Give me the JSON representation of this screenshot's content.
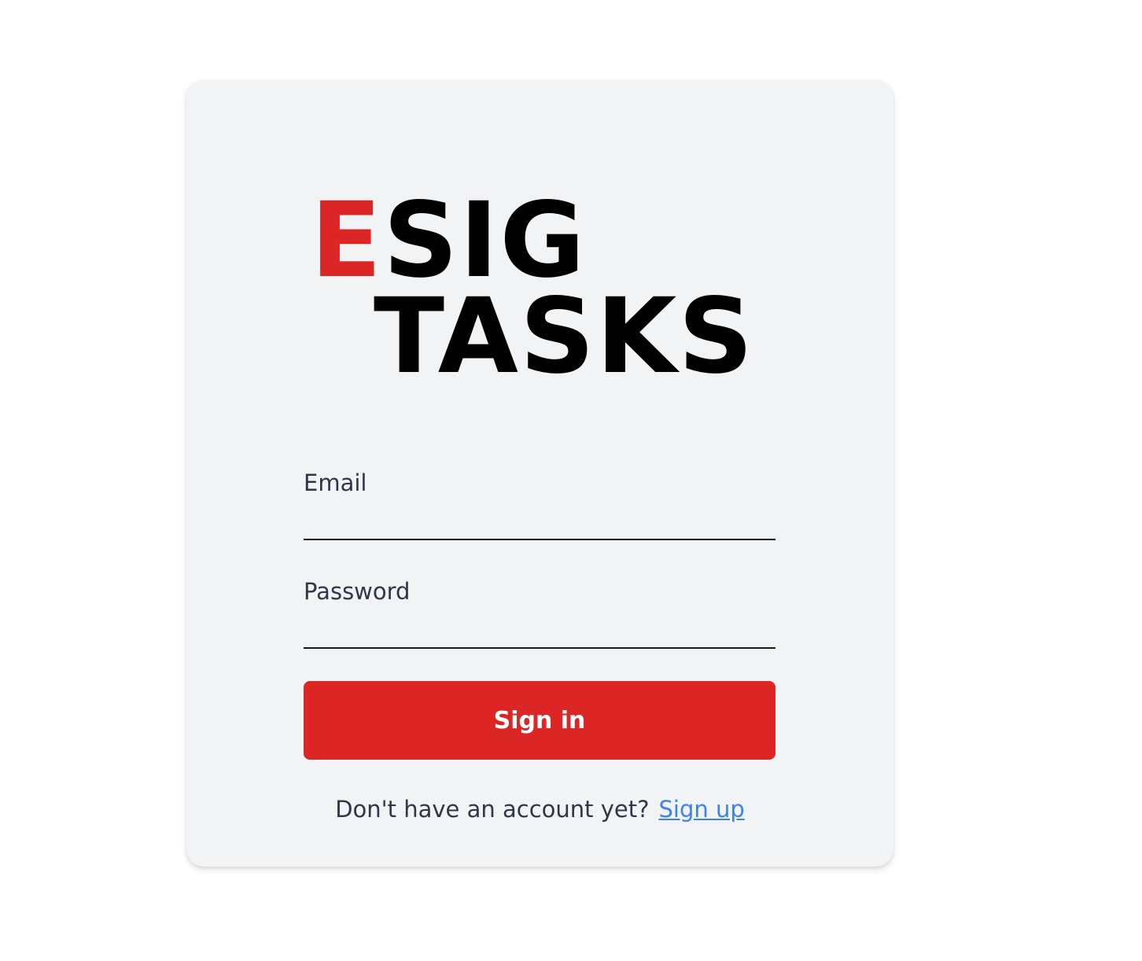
{
  "logo": {
    "accent_letter": "E",
    "line1_rest": "SIG",
    "line2": "TASKS",
    "accent_color": "#dc2626"
  },
  "form": {
    "email_label": "Email",
    "email_value": "",
    "password_label": "Password",
    "password_value": "",
    "submit_label": "Sign in"
  },
  "footer": {
    "prompt": "Don't have an account yet?",
    "signup_link": "Sign up",
    "link_color": "#3b82f6"
  },
  "colors": {
    "page_bg": "#ffffff",
    "card_bg": "#f2f3f5",
    "button_bg": "#dc2626"
  }
}
